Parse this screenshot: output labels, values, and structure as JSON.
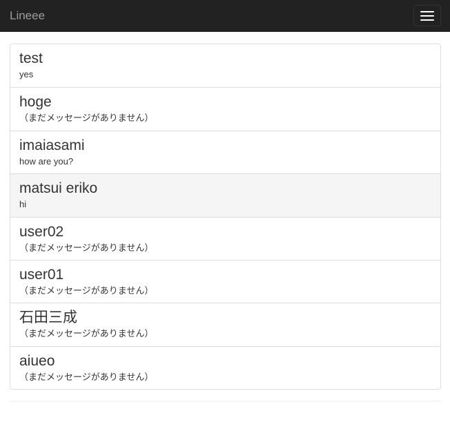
{
  "navbar": {
    "brand": "Lineee",
    "toggle_icon": "hamburger-menu-icon",
    "background": "#222222"
  },
  "list": {
    "items": [
      {
        "name": "test",
        "message": "yes"
      },
      {
        "name": "hoge",
        "message": "（まだメッセージがありません）"
      },
      {
        "name": "imaiasami",
        "message": "how are you?"
      },
      {
        "name": "matsui eriko",
        "message": "hi",
        "active": true
      },
      {
        "name": "user02",
        "message": "（まだメッセージがありません）"
      },
      {
        "name": "user01",
        "message": "（まだメッセージがありません）"
      },
      {
        "name": "石田三成",
        "message": "（まだメッセージがありません）"
      },
      {
        "name": "aiueo",
        "message": "（まだメッセージがありません）"
      }
    ]
  }
}
